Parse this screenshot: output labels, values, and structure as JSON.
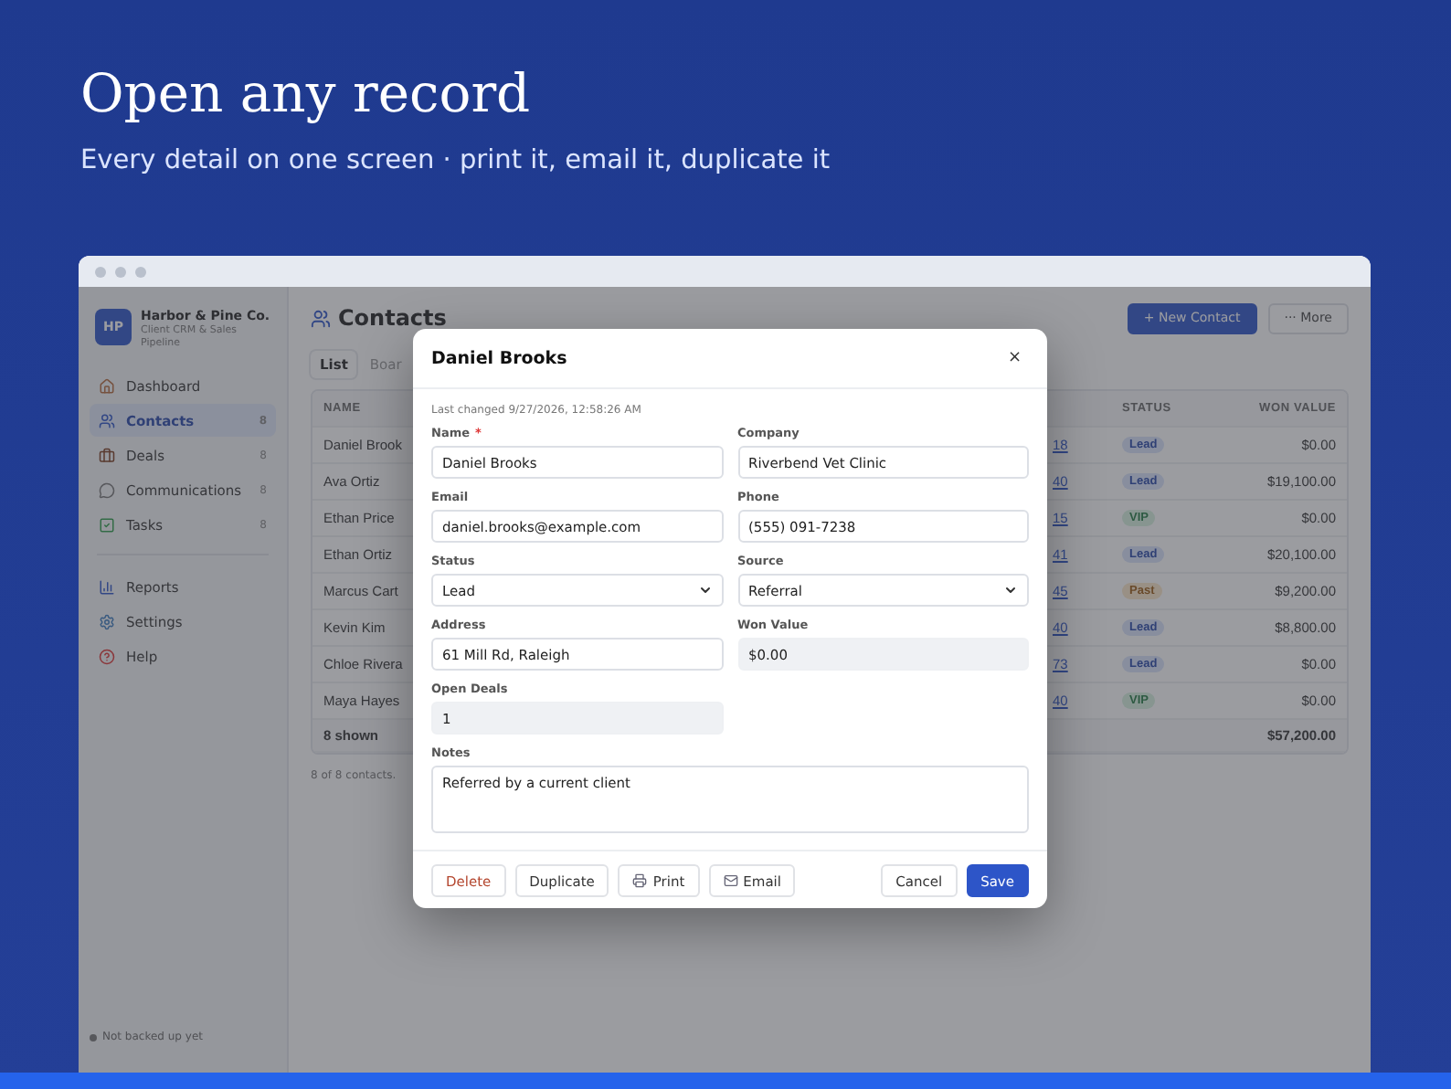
{
  "hero": {
    "title": "Open any record",
    "subtitle": "Every detail on one screen · print it, email it, duplicate it"
  },
  "sidebar": {
    "logo": "HP",
    "company": "Harbor & Pine Co.",
    "tagline": "Client CRM & Sales Pipeline",
    "items": [
      {
        "label": "Dashboard",
        "selected": false
      },
      {
        "label": "Contacts",
        "count": "8",
        "selected": true
      },
      {
        "label": "Deals",
        "count": "8",
        "selected": false
      },
      {
        "label": "Communications",
        "count": "8",
        "selected": false
      },
      {
        "label": "Tasks",
        "count": "8",
        "selected": false
      }
    ],
    "secondary_items": [
      {
        "label": "Reports",
        "selected": false
      },
      {
        "label": "Settings",
        "selected": false
      },
      {
        "label": "Help",
        "selected": false
      }
    ],
    "status": "Not backed up yet"
  },
  "page": {
    "title": "Contacts",
    "buttons": [
      {
        "label": "+ New Contact",
        "kind": "primary"
      },
      {
        "label": "··· More",
        "kind": "secondary"
      }
    ],
    "tabs": [
      {
        "label": "List",
        "selected": true
      },
      {
        "label": "Boar",
        "selected": false
      }
    ]
  },
  "table": {
    "columns": [
      "NAME",
      "STATUS",
      "WON VALUE"
    ],
    "rows": [
      {
        "name": "Daniel Brook",
        "column_3": "18",
        "status": "Lead",
        "won_value": "$0.00"
      },
      {
        "name": "Ava Ortiz",
        "column_3": "40",
        "status": "Lead",
        "won_value": "$19,100.00"
      },
      {
        "name": "Ethan Price",
        "column_3": "15",
        "status": "VIP",
        "won_value": "$0.00"
      },
      {
        "name": "Ethan Ortiz",
        "column_3": "41",
        "status": "Lead",
        "won_value": "$20,100.00"
      },
      {
        "name": "Marcus Cart",
        "column_3": "45",
        "status": "Past",
        "won_value": "$9,200.00"
      },
      {
        "name": "Kevin Kim",
        "column_3": "40",
        "status": "Lead",
        "won_value": "$8,800.00"
      },
      {
        "name": "Chloe Rivera",
        "column_3": "73",
        "status": "Lead",
        "won_value": "$0.00"
      },
      {
        "name": "Maya Hayes",
        "column_3": "40",
        "status": "VIP",
        "won_value": "$0.00"
      }
    ],
    "footer": {
      "count": "8 shown",
      "total": "$57,200.00"
    },
    "note": "8 of 8 contacts."
  },
  "dialog": {
    "title": "Daniel Brooks",
    "close": "×",
    "last_changed": "Last changed 9/27/2026, 12:58:26 AM",
    "fields": [
      {
        "label": "Name",
        "required_mark": "*",
        "kind": "text",
        "value": "Daniel Brooks"
      },
      {
        "label": "Company",
        "kind": "text",
        "value": "Riverbend Vet Clinic"
      },
      {
        "label": "Email",
        "kind": "text",
        "value": "daniel.brooks@example.com"
      },
      {
        "label": "Phone",
        "kind": "text",
        "value": "(555) 091-7238"
      },
      {
        "label": "Status",
        "kind": "select",
        "value": "Lead"
      },
      {
        "label": "Source",
        "kind": "select",
        "value": "Referral"
      },
      {
        "label": "Address",
        "kind": "text",
        "value": "61 Mill Rd, Raleigh"
      },
      {
        "label": "Won Value",
        "kind": "readonly",
        "value": "$0.00"
      },
      {
        "label": "Open Deals",
        "kind": "readonly",
        "value": "1"
      },
      {
        "label": "Notes",
        "kind": "textarea",
        "value": "Referred by a current client"
      }
    ],
    "left_buttons": [
      {
        "label": "Delete",
        "kind": "danger"
      },
      {
        "label": "Duplicate",
        "kind": "plain"
      },
      {
        "label": "Print",
        "kind": "plain"
      },
      {
        "label": "Email",
        "kind": "plain"
      }
    ],
    "right_buttons": [
      {
        "label": "Cancel",
        "kind": "plain"
      },
      {
        "label": "Save",
        "kind": "primary"
      }
    ]
  }
}
